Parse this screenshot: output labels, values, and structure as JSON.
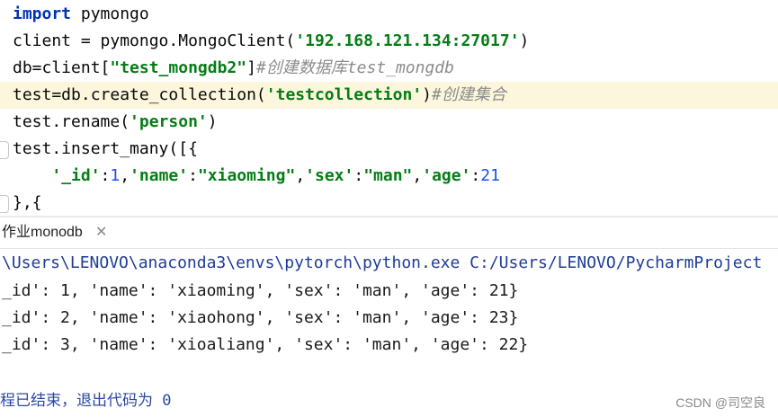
{
  "editor": {
    "lines": [
      {
        "segments": [
          {
            "t": "import",
            "c": "kw"
          },
          {
            "t": " pymongo",
            "c": ""
          }
        ]
      },
      {
        "segments": [
          {
            "t": "client = pymongo.MongoClient(",
            "c": ""
          },
          {
            "t": "'192.168.121.134:27017'",
            "c": "str"
          },
          {
            "t": ")",
            "c": ""
          }
        ]
      },
      {
        "segments": [
          {
            "t": "db=client[",
            "c": ""
          },
          {
            "t": "\"test_mongdb2\"",
            "c": "str"
          },
          {
            "t": "]",
            "c": ""
          },
          {
            "t": "#创建数据库test_mongdb",
            "c": "cmt"
          }
        ]
      },
      {
        "segments": [
          {
            "t": "test=db.create_collection(",
            "c": ""
          },
          {
            "t": "'testcollection'",
            "c": "str"
          },
          {
            "t": ")",
            "c": ""
          },
          {
            "t": "#创建集合",
            "c": "cmt"
          }
        ]
      },
      {
        "segments": [
          {
            "t": "test.rename(",
            "c": ""
          },
          {
            "t": "'person'",
            "c": "str"
          },
          {
            "t": ")",
            "c": ""
          }
        ]
      },
      {
        "segments": [
          {
            "t": "test.insert_many([{",
            "c": ""
          }
        ]
      },
      {
        "segments": [
          {
            "t": "    ",
            "c": ""
          },
          {
            "t": "'_id'",
            "c": "str"
          },
          {
            "t": ":",
            "c": ""
          },
          {
            "t": "1",
            "c": "num"
          },
          {
            "t": ",",
            "c": ""
          },
          {
            "t": "'name'",
            "c": "str"
          },
          {
            "t": ":",
            "c": ""
          },
          {
            "t": "\"xiaoming\"",
            "c": "str"
          },
          {
            "t": ",",
            "c": ""
          },
          {
            "t": "'sex'",
            "c": "str"
          },
          {
            "t": ":",
            "c": ""
          },
          {
            "t": "\"man\"",
            "c": "str"
          },
          {
            "t": ",",
            "c": ""
          },
          {
            "t": "'age'",
            "c": "str"
          },
          {
            "t": ":",
            "c": ""
          },
          {
            "t": "21",
            "c": "num"
          }
        ]
      },
      {
        "segments": [
          {
            "t": "},{",
            "c": ""
          }
        ]
      }
    ]
  },
  "run": {
    "tab_label": "作业monodb",
    "close_glyph": "✕"
  },
  "console": {
    "path_line": "\\Users\\LENOVO\\anaconda3\\envs\\pytorch\\python.exe C:/Users/LENOVO/PycharmProject",
    "outputs": [
      "_id': 1, 'name': 'xiaoming', 'sex': 'man', 'age': 21}",
      "_id': 2, 'name': 'xiaohong', 'sex': 'man', 'age': 23}",
      "_id': 3, 'name': 'xioaliang', 'sex': 'man', 'age': 22}"
    ],
    "exit_text": "程已结束，退出代码为 0"
  },
  "watermark": "CSDN @司空良"
}
